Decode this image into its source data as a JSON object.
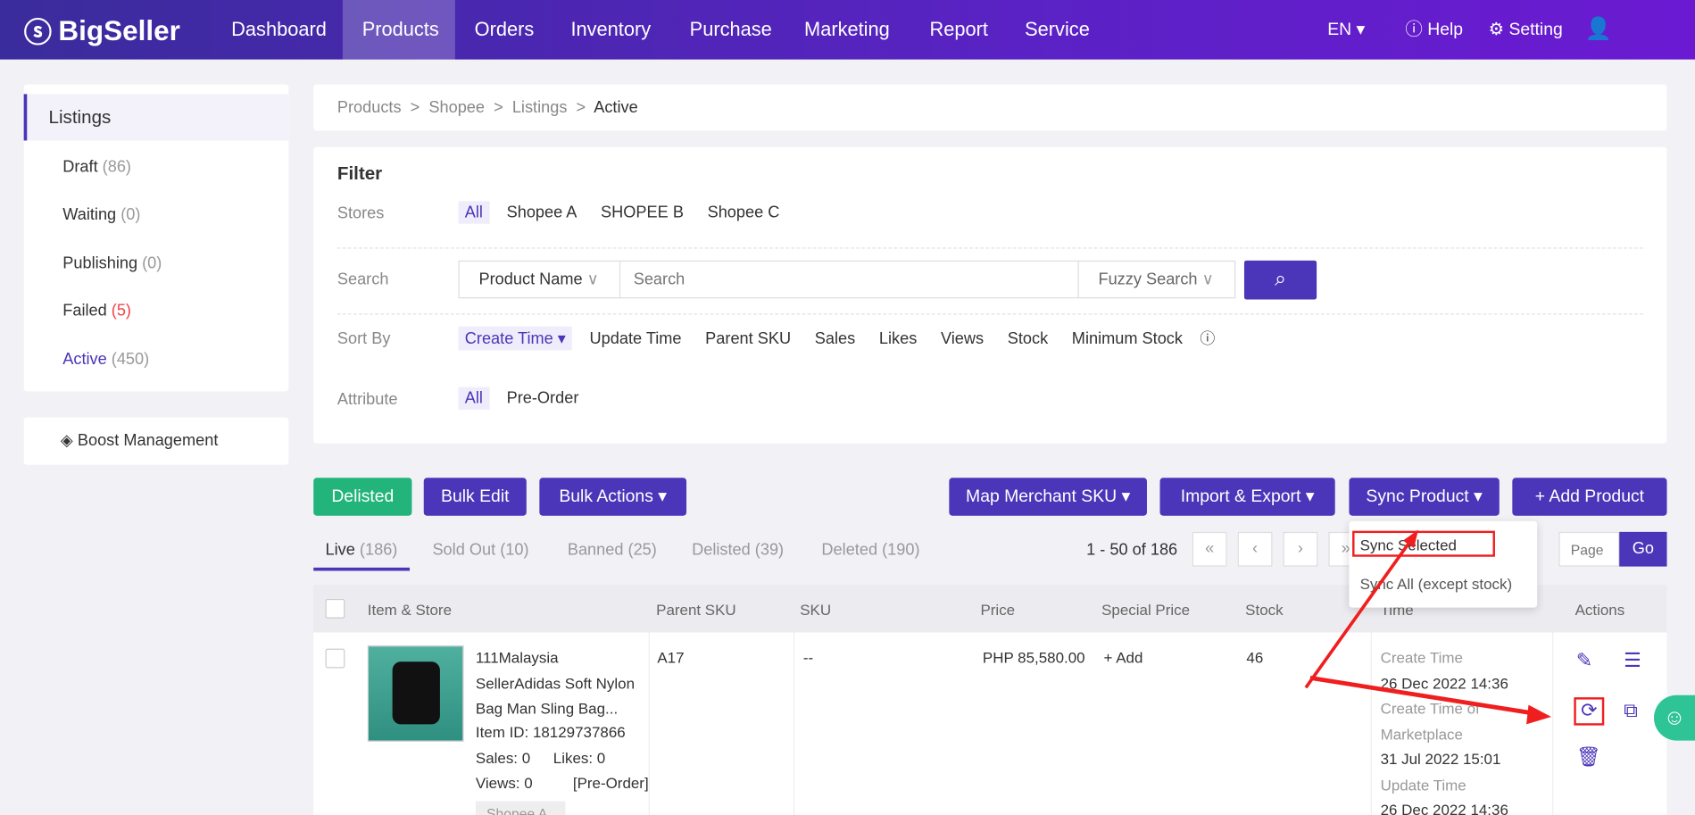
{
  "nav": {
    "brand": "BigSeller",
    "items": [
      "Dashboard",
      "Products",
      "Orders",
      "Inventory",
      "Purchase",
      "Marketing",
      "Report",
      "Service"
    ],
    "active": "Products",
    "lang": "EN",
    "help": "Help",
    "setting": "Setting"
  },
  "sidebar": {
    "header": "Listings",
    "items": [
      {
        "label": "Draft",
        "count": "(86)"
      },
      {
        "label": "Waiting",
        "count": "(0)"
      },
      {
        "label": "Publishing",
        "count": "(0)"
      },
      {
        "label": "Failed",
        "count": "(5)"
      },
      {
        "label": "Active",
        "count": "(450)"
      }
    ],
    "boost": "Boost Management"
  },
  "breadcrumb": [
    "Products",
    "Shopee",
    "Listings",
    "Active"
  ],
  "filter": {
    "title": "Filter",
    "stores_label": "Stores",
    "stores": [
      "All",
      "Shopee A",
      "SHOPEE B",
      "Shopee C"
    ],
    "search_label": "Search",
    "search_field": "Product Name",
    "search_placeholder": "Search",
    "search_mode": "Fuzzy Search",
    "sort_label": "Sort By",
    "sort": [
      "Create Time",
      "Update Time",
      "Parent SKU",
      "Sales",
      "Likes",
      "Views",
      "Stock",
      "Minimum Stock"
    ],
    "attr_label": "Attribute",
    "attrs": [
      "All",
      "Pre-Order"
    ]
  },
  "toolbar": {
    "delisted": "Delisted",
    "bulk_edit": "Bulk Edit",
    "bulk_actions": "Bulk Actions",
    "map_sku": "Map Merchant SKU",
    "import_export": "Import & Export",
    "sync": "Sync Product",
    "add": "+ Add Product"
  },
  "sync_menu": [
    "Sync Selected",
    "Sync All (except stock)"
  ],
  "tabs": [
    {
      "label": "Live",
      "count": "(186)"
    },
    {
      "label": "Sold Out",
      "count": "(10)"
    },
    {
      "label": "Banned",
      "count": "(25)"
    },
    {
      "label": "Delisted",
      "count": "(39)"
    },
    {
      "label": "Deleted",
      "count": "(190)"
    }
  ],
  "pagination": {
    "range": "1 - 50 of 186",
    "page_placeholder": "Page",
    "go": "Go"
  },
  "table": {
    "headers": [
      "Item & Store",
      "Parent SKU",
      "SKU",
      "Price",
      "Special Price",
      "Stock",
      "Time",
      "Actions"
    ],
    "row": {
      "title": [
        "111Malaysia",
        "SellerAdidas Soft Nylon",
        "Bag Man Sling Bag..."
      ],
      "item_id": "Item ID: 18129737866",
      "sales": "Sales: 0",
      "likes": "Likes: 0",
      "views": "Views: 0",
      "preorder": "[Pre-Order]",
      "store": "Shopee A",
      "parent_sku": "A17",
      "sku": "--",
      "price": "PHP 85,580.00",
      "special": "+ Add",
      "stock": "46",
      "times": [
        "Create Time",
        "26 Dec 2022 14:36",
        "Create Time of",
        "Marketplace",
        "31 Jul 2022 15:01",
        "Update Time",
        "26 Dec 2022 14:36"
      ]
    }
  },
  "colors": {
    "accent": "#4b35b8",
    "success": "#22b47a",
    "annotation": "#f01e1e"
  }
}
